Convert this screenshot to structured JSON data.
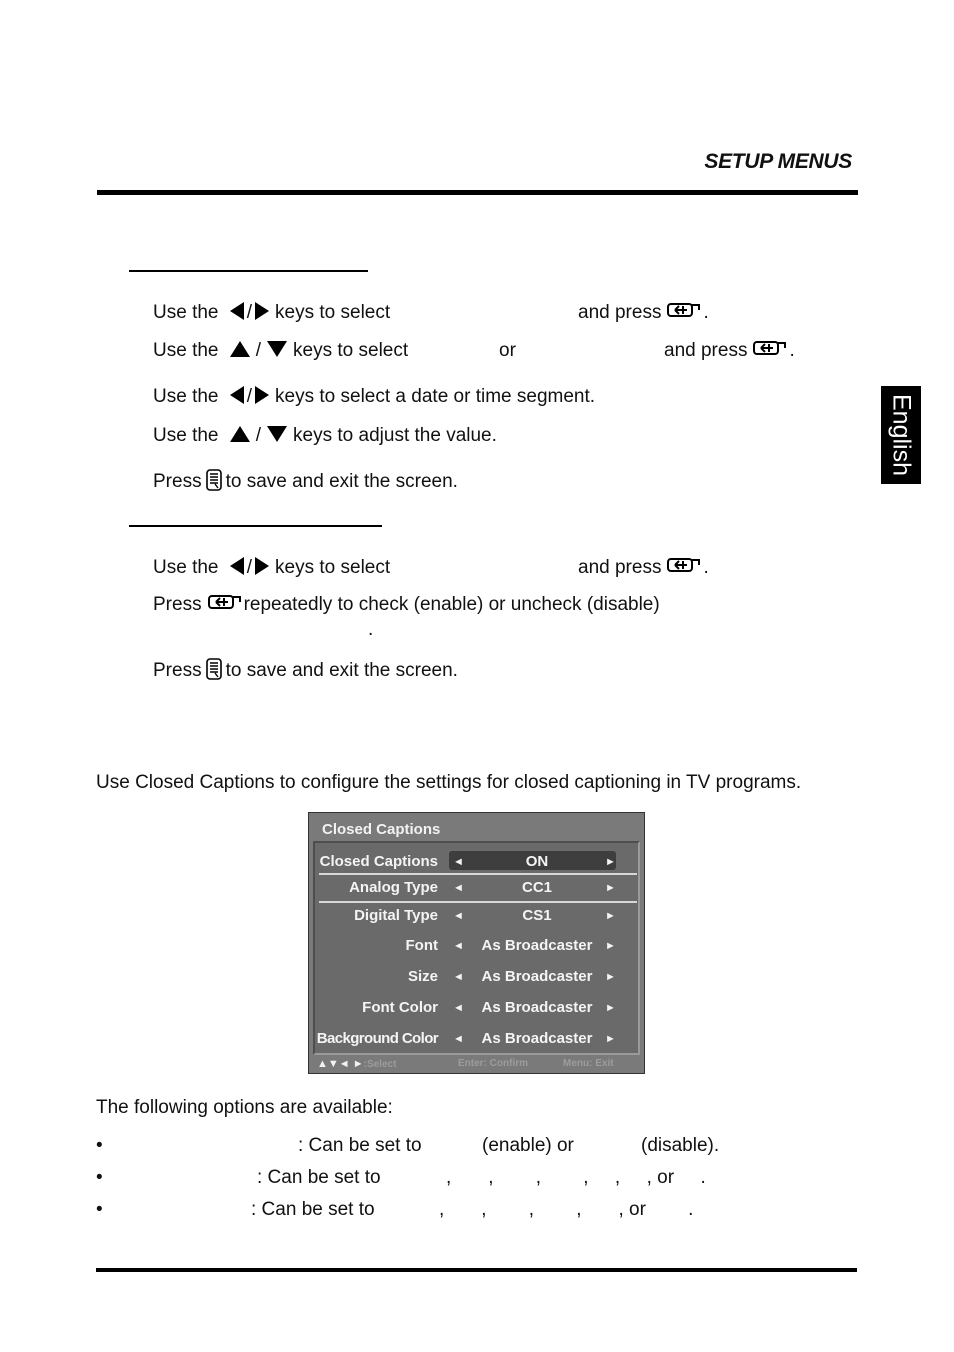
{
  "header": {
    "section_title": "SETUP MENUS"
  },
  "language_tab": "English",
  "date_time_section": {
    "steps": [
      {
        "pre": "Use the",
        "icon1": "left-arrow-key",
        "sep": "/",
        "icon2": "right-arrow-key",
        "text": "keys to select",
        "gap_text": "",
        "post": "and press",
        "end_icon": "enter-key",
        "end": "."
      },
      {
        "pre": "Use the",
        "icon1": "up-arrow-key",
        "sep": "/",
        "icon2": "down-arrow-key",
        "text": "keys to select",
        "or": "or",
        "post": "and press",
        "end_icon": "enter-key",
        "end": "."
      },
      {
        "pre": "Use the",
        "icon1": "left-arrow-key",
        "sep": "/",
        "icon2": "right-arrow-key",
        "text": "keys to select a date or time segment."
      },
      {
        "pre": "Use the",
        "icon1": "up-arrow-key",
        "sep": "/",
        "icon2": "down-arrow-key",
        "text": "keys to adjust the value."
      },
      {
        "pre": "Press",
        "icon1": "menu-key",
        "text": "to save and exit the screen."
      }
    ]
  },
  "second_section": {
    "steps": [
      {
        "pre": "Use the",
        "sep": "/",
        "text": "keys to select",
        "post": "and press",
        "end": "."
      },
      {
        "pre": "Press",
        "text": "repeatedly to check (enable) or uncheck (disable)",
        "cont": "."
      },
      {
        "pre": "Press",
        "text": "to save and exit the screen."
      }
    ]
  },
  "intro": "Use Closed Captions to configure the settings for closed captioning in TV programs.",
  "osd_menu": {
    "title": "Closed Captions",
    "rows": [
      {
        "label": "Closed Captions",
        "value": "ON",
        "selected": true
      },
      {
        "label": "Analog Type",
        "value": "CC1"
      },
      {
        "label": "Digital Type",
        "value": "CS1"
      },
      {
        "label": "Font",
        "value": "As Broadcaster"
      },
      {
        "label": "Size",
        "value": "As Broadcaster"
      },
      {
        "label": "Font Color",
        "value": "As Broadcaster"
      },
      {
        "label": "Background Color",
        "value": "As Broadcaster"
      }
    ],
    "arrow_left": "◄",
    "arrow_right": "►",
    "footer": {
      "nav_keys": "▲▼◄ ►",
      "select": ":Select",
      "confirm": "Enter: Confirm",
      "exit": "Menu: Exit"
    },
    "colors": {
      "panel": "#7a7a7b",
      "inner": "#6a6a6b",
      "highlight": "#3e3e3f",
      "text": "#f4f4f4"
    }
  },
  "options": {
    "heading": "The following options are available:",
    "bullets": [
      {
        "bullet": "•",
        "text": ": Can be set to",
        "a": "(enable) or",
        "b": "(disable)."
      },
      {
        "bullet": "•",
        "text": ": Can be set to",
        "list": ",       ,        ,        ,     ,     , or     ."
      },
      {
        "bullet": "•",
        "text": ": Can be set to",
        "list": ",       ,        ,        ,       , or        ."
      }
    ]
  }
}
